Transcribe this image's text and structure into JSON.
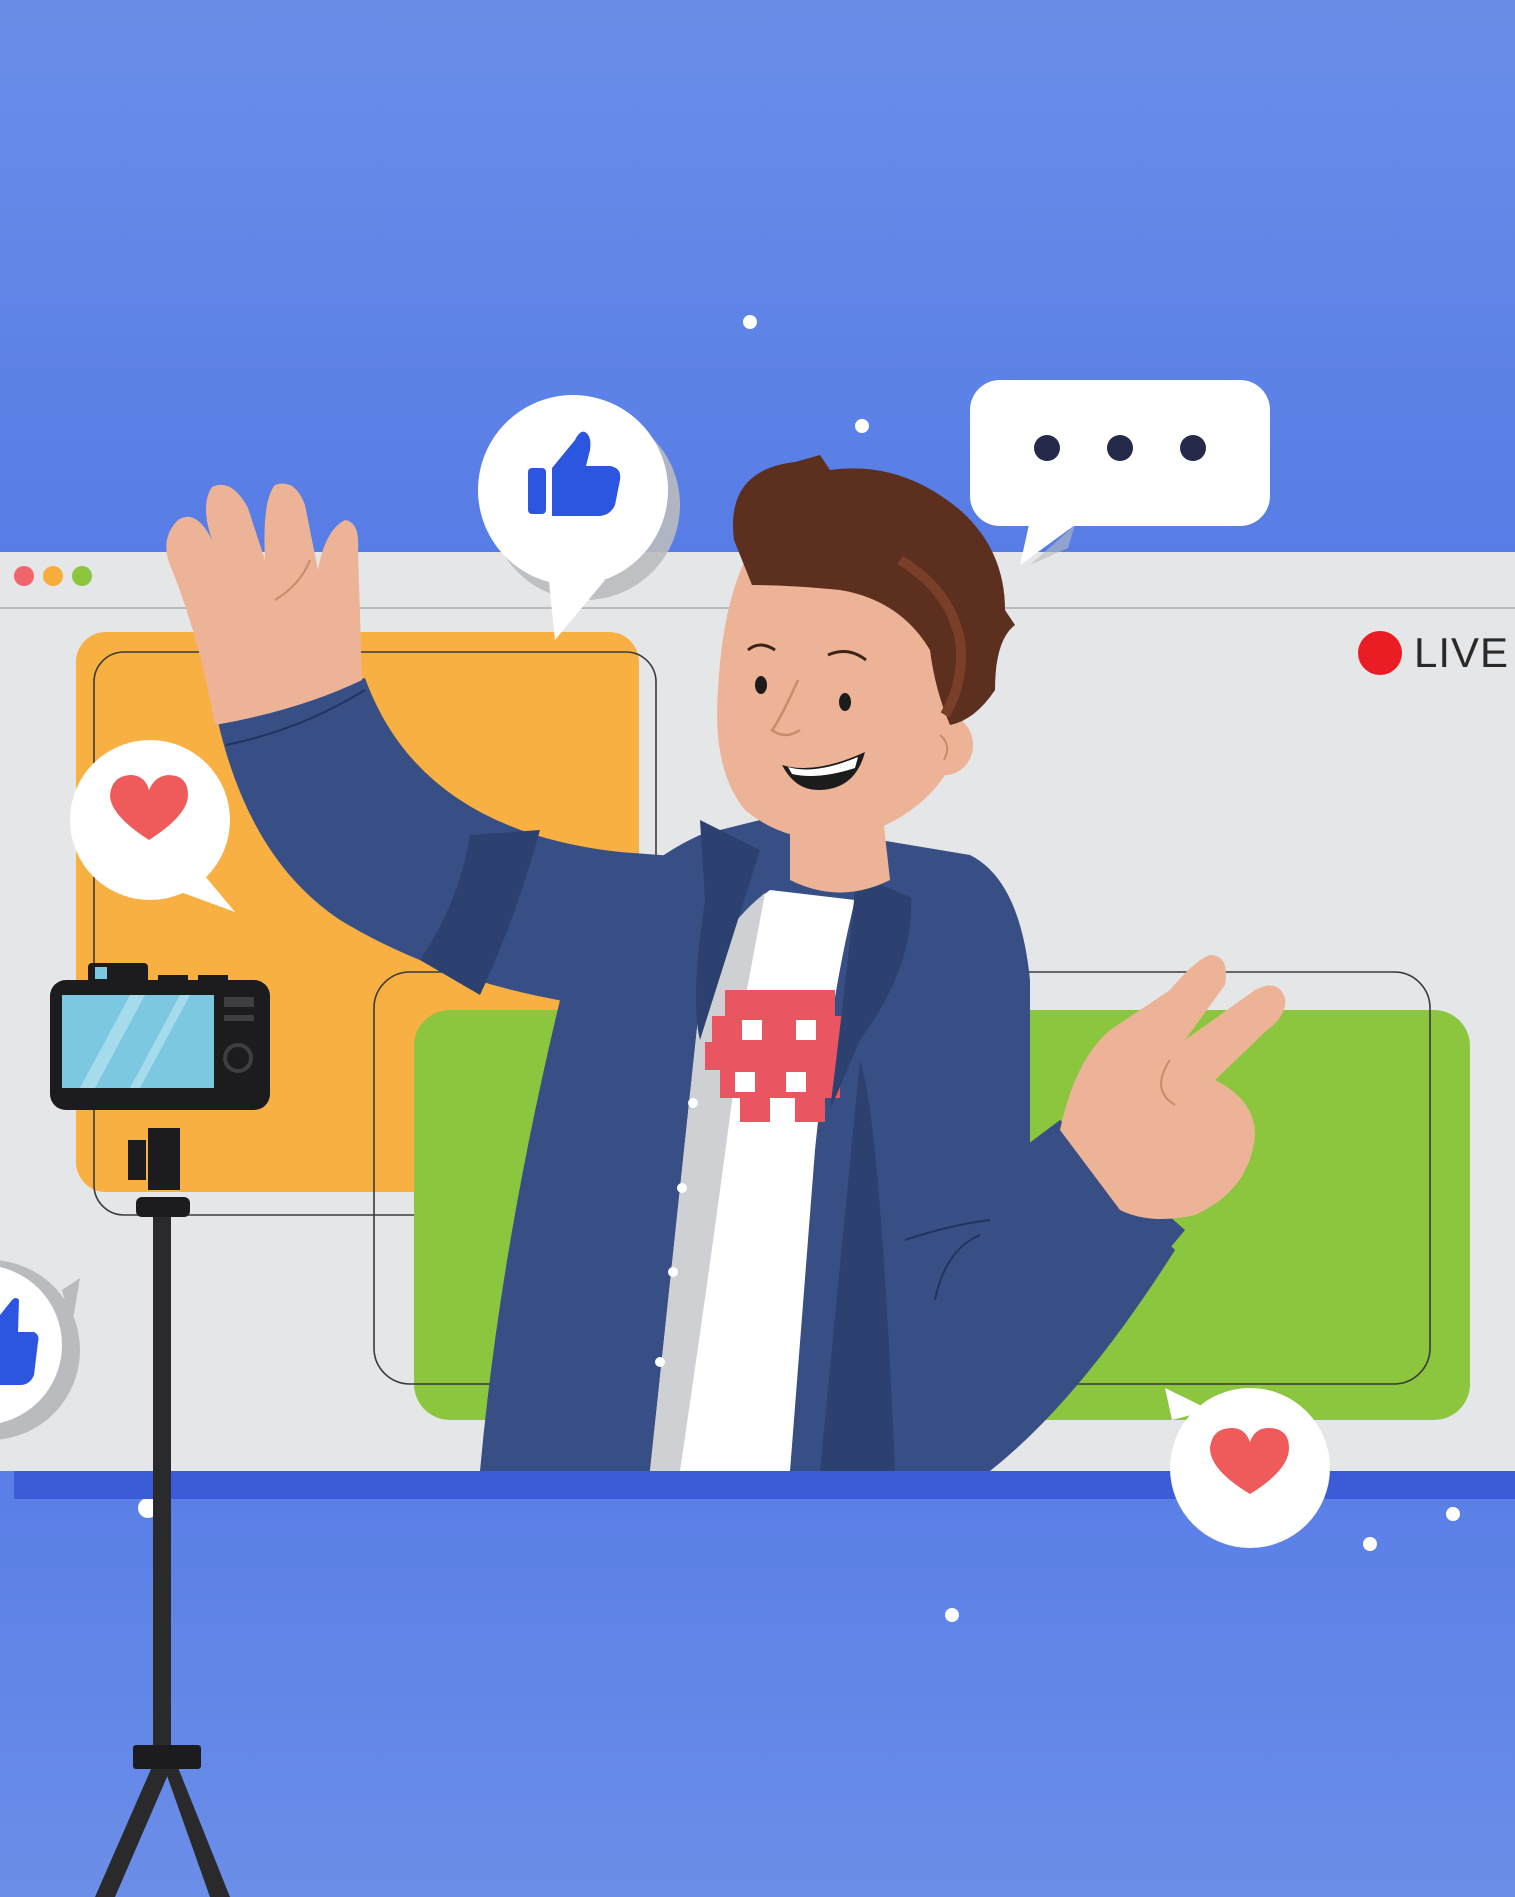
{
  "live_badge": {
    "label": "LIVE",
    "dot_color": "#ea1c24"
  },
  "colors": {
    "background": "#5b7fe6",
    "window_frame": "#e5e6e8",
    "panel_orange": "#f8b043",
    "panel_green": "#8cc63f",
    "jacket": "#384f86",
    "skin": "#edb397",
    "hair": "#5c2f1f",
    "shirt_print": "#e95560",
    "like_blue": "#2c56e0",
    "heart_red": "#ef5b5b"
  },
  "icons": {
    "window_controls": [
      "red-dot-icon",
      "yellow-dot-icon",
      "green-dot-icon"
    ],
    "reactions": [
      "thumbs-up-icon",
      "typing-dots-icon",
      "heart-icon",
      "heart-icon",
      "thumbs-up-icon"
    ],
    "device": "camera-on-tripod-icon"
  }
}
